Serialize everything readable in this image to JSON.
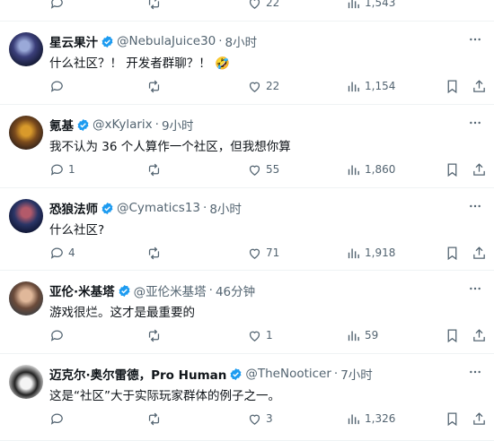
{
  "colors": {
    "accent": "#1d9bf0",
    "muted": "#536471",
    "text": "#0f1419",
    "divider": "#eff3f4"
  },
  "top_row": {
    "likes": "22",
    "views": "1,543"
  },
  "posts": [
    {
      "name": "星云果汁",
      "handle": "@NebulaJuice30",
      "time": "8小时",
      "text": "什么社区？！ 开发者群聊？！ 🤣",
      "replies": "",
      "reposts": "",
      "likes": "22",
      "views": "1,154"
    },
    {
      "name": "氪基",
      "handle": "@xKylarix",
      "time": "9小时",
      "text": "我不认为 36 个人算作一个社区，但我想你算",
      "replies": "1",
      "reposts": "",
      "likes": "55",
      "views": "1,860"
    },
    {
      "name": "恐狼法师",
      "handle": "@Cymatics13",
      "time": "8小时",
      "text": "什么社区?",
      "replies": "4",
      "reposts": "",
      "likes": "71",
      "views": "1,918"
    },
    {
      "name": "亚伦·米基塔",
      "handle": "@亚伦米基塔",
      "time": "46分钟",
      "text": "游戏很烂。这才是最重要的",
      "replies": "",
      "reposts": "",
      "likes": "1",
      "views": "59"
    },
    {
      "name": "迈克尔·奥尔雷德，Pro Human",
      "handle": "@TheNooticer",
      "time": "7小时",
      "text": "这是“社区”大于实际玩家群体的例子之一。",
      "replies": "",
      "reposts": "",
      "likes": "3",
      "views": "1,326"
    }
  ],
  "separator": "·"
}
